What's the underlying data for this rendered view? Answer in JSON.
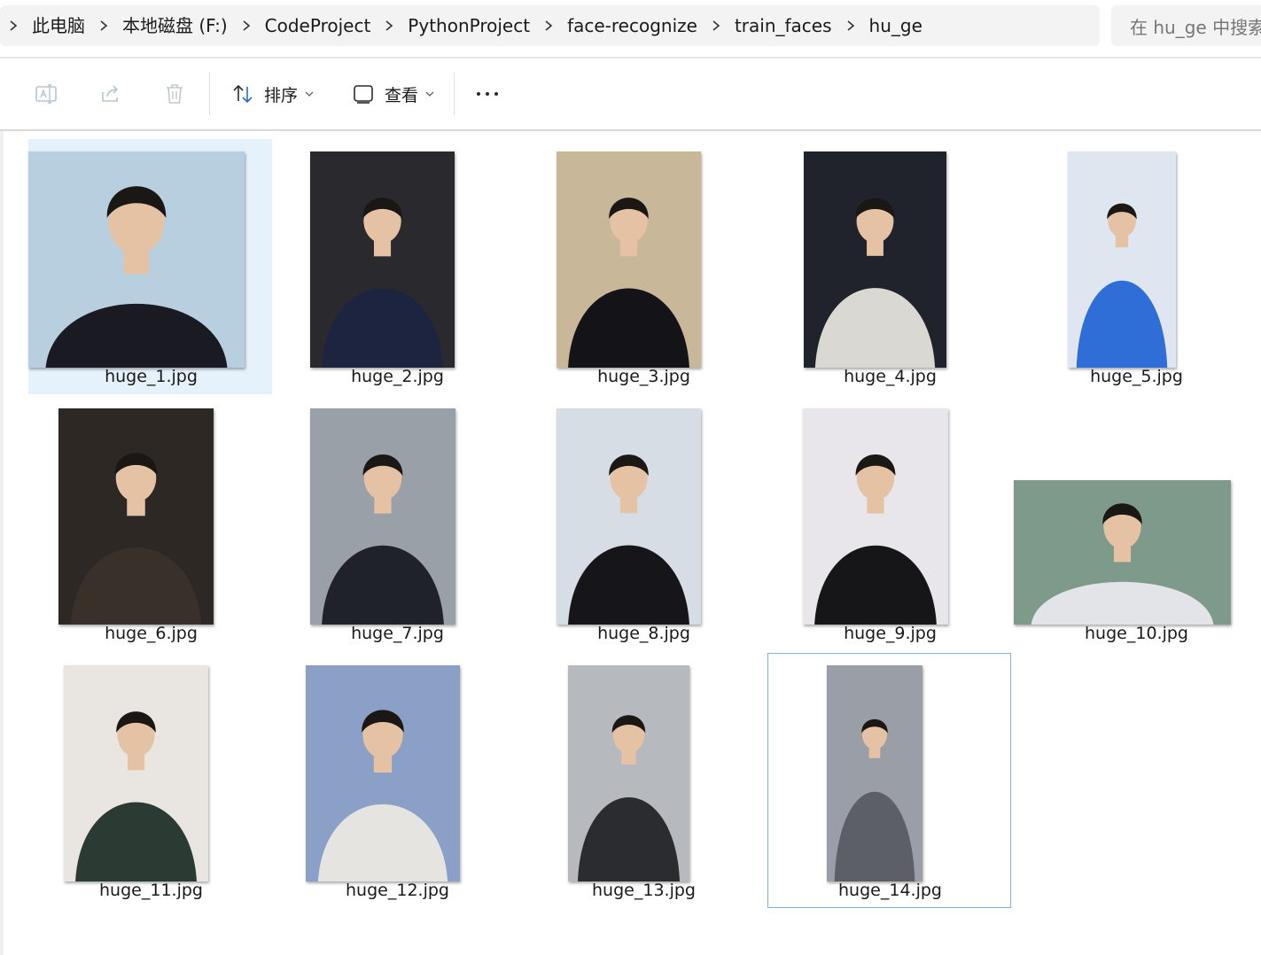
{
  "breadcrumb": [
    {
      "label": "此电脑"
    },
    {
      "label": "本地磁盘 (F:)"
    },
    {
      "label": "CodeProject"
    },
    {
      "label": "PythonProject"
    },
    {
      "label": "face-recognize"
    },
    {
      "label": "train_faces"
    },
    {
      "label": "hu_ge"
    }
  ],
  "search": {
    "placeholder": "在 hu_ge 中搜索"
  },
  "toolbar": {
    "rename_icon": "rename-icon",
    "share_icon": "share-icon",
    "delete_icon": "trash-icon",
    "sort_label": "排序",
    "view_label": "查看",
    "more_icon": "more-icon"
  },
  "files": [
    {
      "name": "huge_1.jpg",
      "bg": "#b8cfe0",
      "fg": "#1a1a22",
      "selected": true
    },
    {
      "name": "huge_2.jpg",
      "bg": "#2a2a2e",
      "fg": "#1d2440"
    },
    {
      "name": "huge_3.jpg",
      "bg": "#c9b79a",
      "fg": "#141418"
    },
    {
      "name": "huge_4.jpg",
      "bg": "#20232b",
      "fg": "#d9d8d2"
    },
    {
      "name": "huge_5.jpg",
      "bg": "#dfe6ef",
      "fg": "#2f6ed6"
    },
    {
      "name": "huge_6.jpg",
      "bg": "#2d2824",
      "fg": "#3a302a"
    },
    {
      "name": "huge_7.jpg",
      "bg": "#9aa0a8",
      "fg": "#1f222a"
    },
    {
      "name": "huge_8.jpg",
      "bg": "#d7dde4",
      "fg": "#16161a"
    },
    {
      "name": "huge_9.jpg",
      "bg": "#e8e6ea",
      "fg": "#161618"
    },
    {
      "name": "huge_10.jpg",
      "bg": "#7e9a8a",
      "fg": "#e2e4e8"
    },
    {
      "name": "huge_11.jpg",
      "bg": "#e9e6e2",
      "fg": "#2c3a34"
    },
    {
      "name": "huge_12.jpg",
      "bg": "#8aa0c6",
      "fg": "#e6e4e0"
    },
    {
      "name": "huge_13.jpg",
      "bg": "#b6b9bd",
      "fg": "#2a2c30"
    },
    {
      "name": "huge_14.jpg",
      "bg": "#9a9ea6",
      "fg": "#5c5f66",
      "focused": true
    }
  ],
  "colors": {
    "selection": "#e5f1fb",
    "focus_border": "#7fb3e0",
    "skin": "#e6c2a4",
    "hair": "#1b1714"
  }
}
